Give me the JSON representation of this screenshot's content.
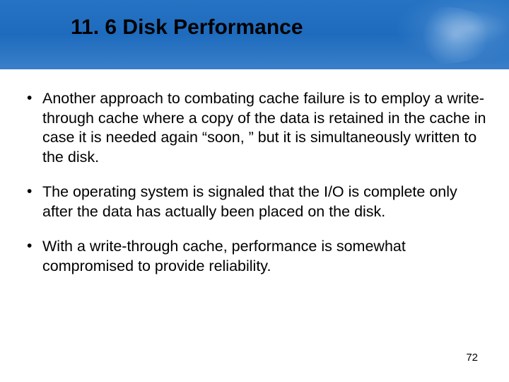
{
  "slide": {
    "title": "11. 6 Disk Performance",
    "bullets": [
      "Another approach to combating cache failure is to employ a write-through cache where a copy of the data is retained in the cache in case it is needed again “soon, ” but it is simultaneously written to the disk.",
      "The operating system is signaled that the I/O is complete only after the data has actually been placed on the disk.",
      "With a write-through cache, performance is somewhat compromised to provide reliability."
    ],
    "page_number": "72"
  }
}
